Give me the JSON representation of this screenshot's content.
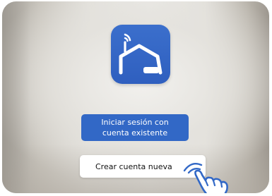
{
  "app": {
    "icon_name": "house-antenna-icon",
    "accent_color": "#3268c6"
  },
  "actions": {
    "login_label": "Iniciar sesión con cuenta existente",
    "create_label": "Crear cuenta nueva"
  },
  "pointer": {
    "icon_name": "tap-hand-icon",
    "color": "#3268c6"
  }
}
